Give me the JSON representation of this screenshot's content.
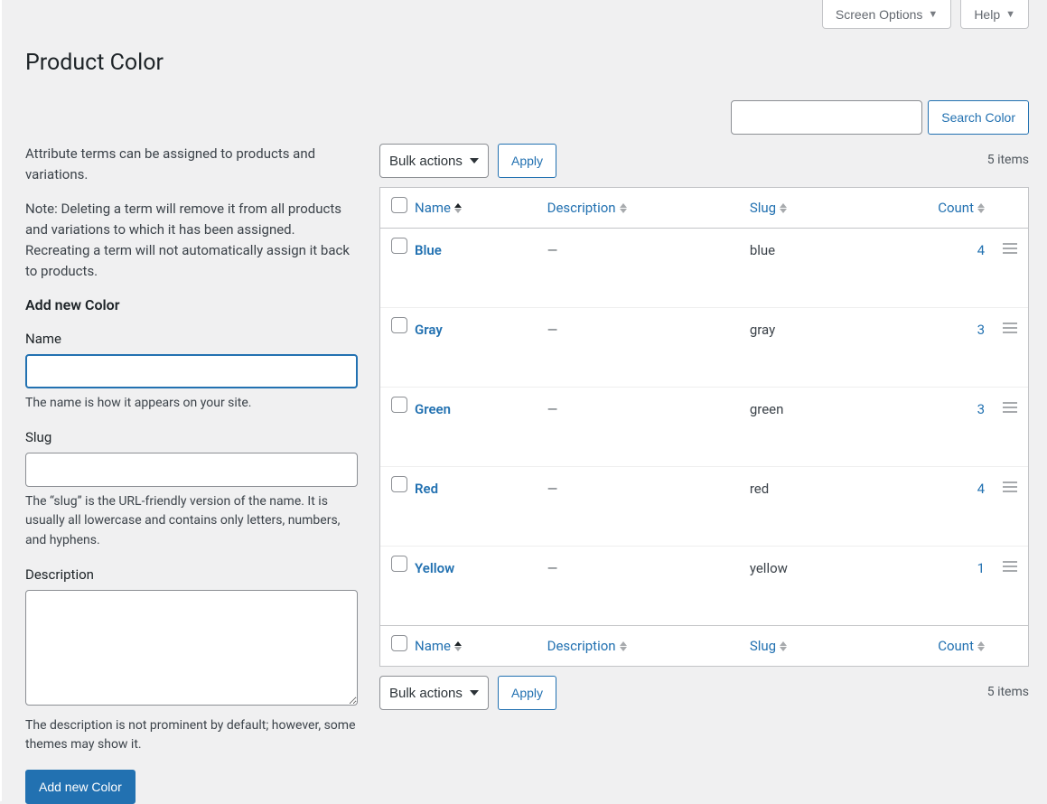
{
  "screen_meta": {
    "screen_options": "Screen Options",
    "help": "Help"
  },
  "page_title": "Product Color",
  "search": {
    "value": "",
    "button": "Search Color"
  },
  "intro_text": "Attribute terms can be assigned to products and variations.",
  "note_text": "Note: Deleting a term will remove it from all products and variations to which it has been assigned. Recreating a term will not automatically assign it back to products.",
  "form": {
    "heading": "Add new Color",
    "name_label": "Name",
    "name_value": "",
    "name_help": "The name is how it appears on your site.",
    "slug_label": "Slug",
    "slug_value": "",
    "slug_help": "The “slug” is the URL-friendly version of the name. It is usually all lowercase and contains only letters, numbers, and hyphens.",
    "desc_label": "Description",
    "desc_value": "",
    "desc_help": "The description is not prominent by default; however, some themes may show it.",
    "submit": "Add new Color"
  },
  "bulk": {
    "selected": "Bulk actions",
    "apply": "Apply"
  },
  "items_count_text": "5 items",
  "table": {
    "headers": {
      "name": "Name",
      "description": "Description",
      "slug": "Slug",
      "count": "Count"
    },
    "rows": [
      {
        "name": "Blue",
        "description": "—",
        "slug": "blue",
        "count": "4"
      },
      {
        "name": "Gray",
        "description": "—",
        "slug": "gray",
        "count": "3"
      },
      {
        "name": "Green",
        "description": "—",
        "slug": "green",
        "count": "3"
      },
      {
        "name": "Red",
        "description": "—",
        "slug": "red",
        "count": "4"
      },
      {
        "name": "Yellow",
        "description": "—",
        "slug": "yellow",
        "count": "1"
      }
    ]
  }
}
